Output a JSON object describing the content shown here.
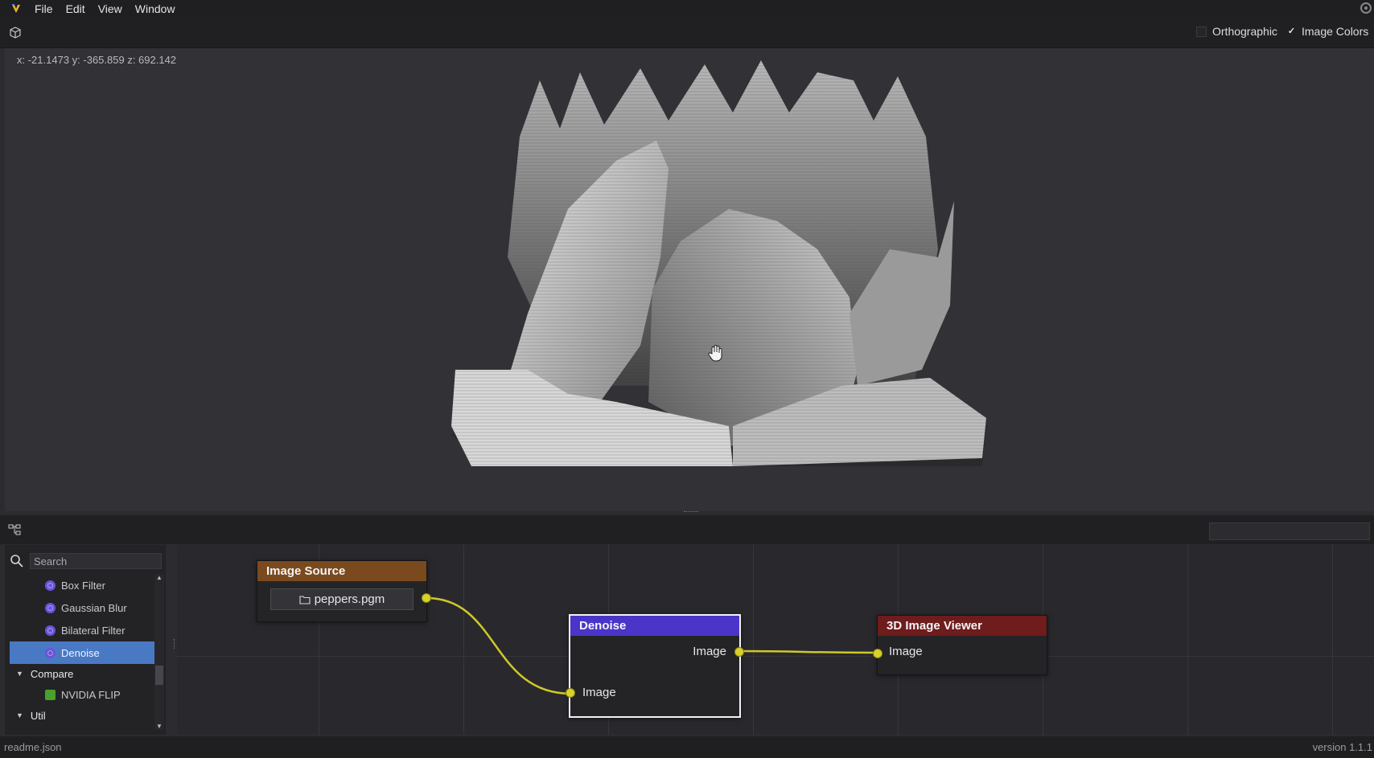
{
  "menu": {
    "items": [
      "File",
      "Edit",
      "View",
      "Window"
    ]
  },
  "viewer": {
    "options": {
      "orthographic": {
        "label": "Orthographic",
        "checked": false
      },
      "image_colors": {
        "label": "Image Colors",
        "checked": true,
        "check_mark": "✓"
      }
    },
    "coordinates": "x: -21.1473 y: -365.859 z: 692.142"
  },
  "sidebar": {
    "search_placeholder": "Search",
    "items": [
      {
        "label": "Box Filter",
        "icon": "node-filter-icon"
      },
      {
        "label": "Gaussian Blur",
        "icon": "node-filter-icon"
      },
      {
        "label": "Bilateral Filter",
        "icon": "node-filter-icon"
      },
      {
        "label": "Denoise",
        "icon": "node-filter-icon",
        "selected": true
      }
    ],
    "categories": {
      "compare": {
        "label": "Compare",
        "items": [
          {
            "label": "NVIDIA FLIP",
            "icon": "nvidia-flip-icon"
          }
        ]
      },
      "util": {
        "label": "Util"
      }
    }
  },
  "nodes": {
    "image_source": {
      "title": "Image Source",
      "file": "peppers.pgm",
      "color": "#7a4a1e"
    },
    "denoise": {
      "title": "Denoise",
      "input": "Image",
      "output": "Image",
      "color": "#4a35c8"
    },
    "viewer3d": {
      "title": "3D Image Viewer",
      "input": "Image",
      "color": "#6e1c1c"
    }
  },
  "status": {
    "file": "readme.json",
    "version": "version 1.1.1"
  },
  "colors": {
    "wire": "#cfc82a",
    "selection": "#4a79c4"
  }
}
